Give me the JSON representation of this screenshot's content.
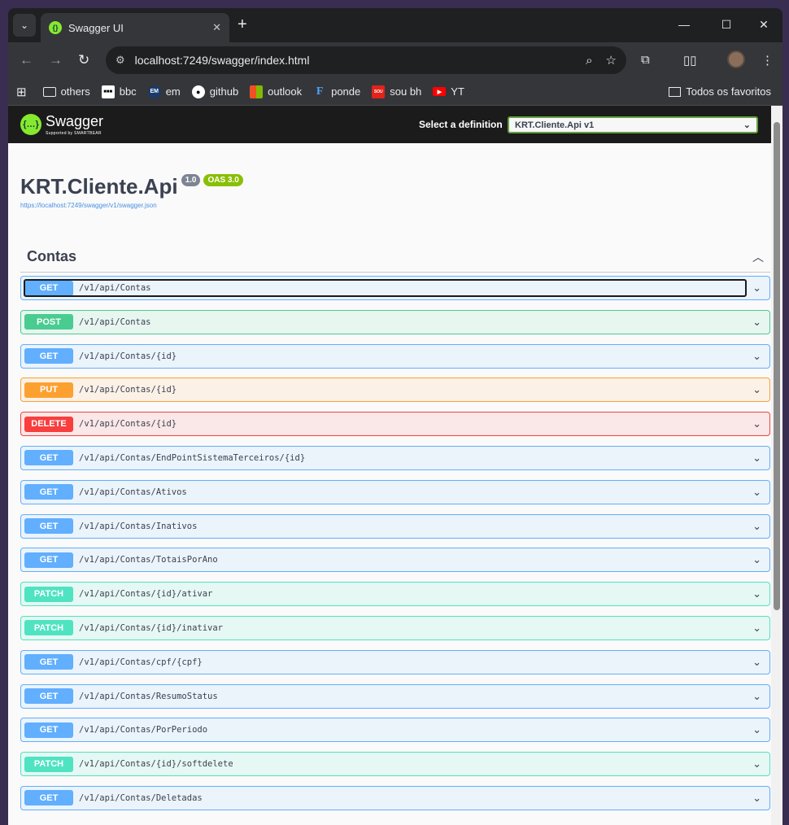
{
  "browser": {
    "tab_title": "Swagger UI",
    "url": "localhost:7249/swagger/index.html",
    "bookmarks": [
      {
        "label": "others",
        "icon": "folder-icon"
      },
      {
        "label": "bbc",
        "icon": "bbc-icon"
      },
      {
        "label": "em",
        "icon": "em-icon"
      },
      {
        "label": "github",
        "icon": "github-icon"
      },
      {
        "label": "outlook",
        "icon": "windows-icon"
      },
      {
        "label": "ponde",
        "icon": "ponde-icon"
      },
      {
        "label": "sou bh",
        "icon": "soubh-icon"
      },
      {
        "label": "YT",
        "icon": "youtube-icon"
      }
    ],
    "all_bookmarks": "Todos os favoritos"
  },
  "swagger": {
    "logo_text": "Swagger",
    "logo_sub": "Supported by SMARTBEAR",
    "definition_label": "Select a definition",
    "definition_value": "KRT.Cliente.Api v1",
    "api_title": "KRT.Cliente.Api",
    "version_badge": "1.0",
    "oas_badge": "OAS 3.0",
    "spec_url": "https://localhost:7249/swagger/v1/swagger.json",
    "tag": "Contas",
    "operations": [
      {
        "method": "GET",
        "path": "/v1/api/Contas"
      },
      {
        "method": "POST",
        "path": "/v1/api/Contas"
      },
      {
        "method": "GET",
        "path": "/v1/api/Contas/{id}"
      },
      {
        "method": "PUT",
        "path": "/v1/api/Contas/{id}"
      },
      {
        "method": "DELETE",
        "path": "/v1/api/Contas/{id}"
      },
      {
        "method": "GET",
        "path": "/v1/api/Contas/EndPointSistemaTerceiros/{id}"
      },
      {
        "method": "GET",
        "path": "/v1/api/Contas/Ativos"
      },
      {
        "method": "GET",
        "path": "/v1/api/Contas/Inativos"
      },
      {
        "method": "GET",
        "path": "/v1/api/Contas/TotaisPorAno"
      },
      {
        "method": "PATCH",
        "path": "/v1/api/Contas/{id}/ativar"
      },
      {
        "method": "PATCH",
        "path": "/v1/api/Contas/{id}/inativar"
      },
      {
        "method": "GET",
        "path": "/v1/api/Contas/cpf/{cpf}"
      },
      {
        "method": "GET",
        "path": "/v1/api/Contas/ResumoStatus"
      },
      {
        "method": "GET",
        "path": "/v1/api/Contas/PorPeriodo"
      },
      {
        "method": "PATCH",
        "path": "/v1/api/Contas/{id}/softdelete"
      },
      {
        "method": "GET",
        "path": "/v1/api/Contas/Deletadas"
      }
    ]
  },
  "colors": {
    "get": "#61affe",
    "post": "#49cc90",
    "put": "#fca130",
    "delete": "#f93e3e",
    "patch": "#50e3c2",
    "swagger_green": "#85ea2d"
  }
}
